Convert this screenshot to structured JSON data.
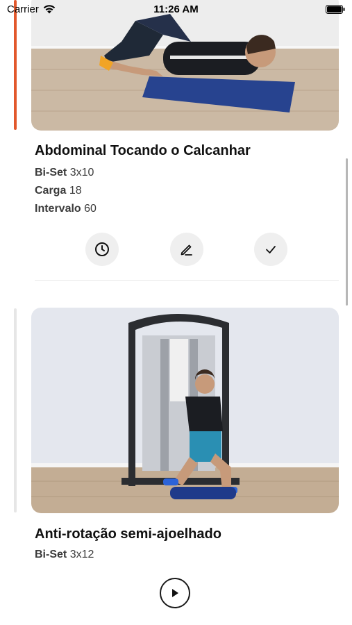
{
  "status_bar": {
    "carrier": "Carrier",
    "time": "11:26 AM"
  },
  "exercises": [
    {
      "title": "Abdominal Tocando o Calcanhar",
      "details": [
        {
          "label": "Bi-Set",
          "value": "3x10"
        },
        {
          "label": "Carga",
          "value": "18"
        },
        {
          "label": "Intervalo",
          "value": "60"
        }
      ],
      "actions": [
        "clock-icon",
        "edit-pencil-icon",
        "checkmark-icon"
      ],
      "accent_color": "#e2582c"
    },
    {
      "title": "Anti-rotação semi-ajoelhado",
      "details": [
        {
          "label": "Bi-Set",
          "value": "3x12"
        }
      ],
      "actions": [
        "play-icon"
      ]
    }
  ]
}
